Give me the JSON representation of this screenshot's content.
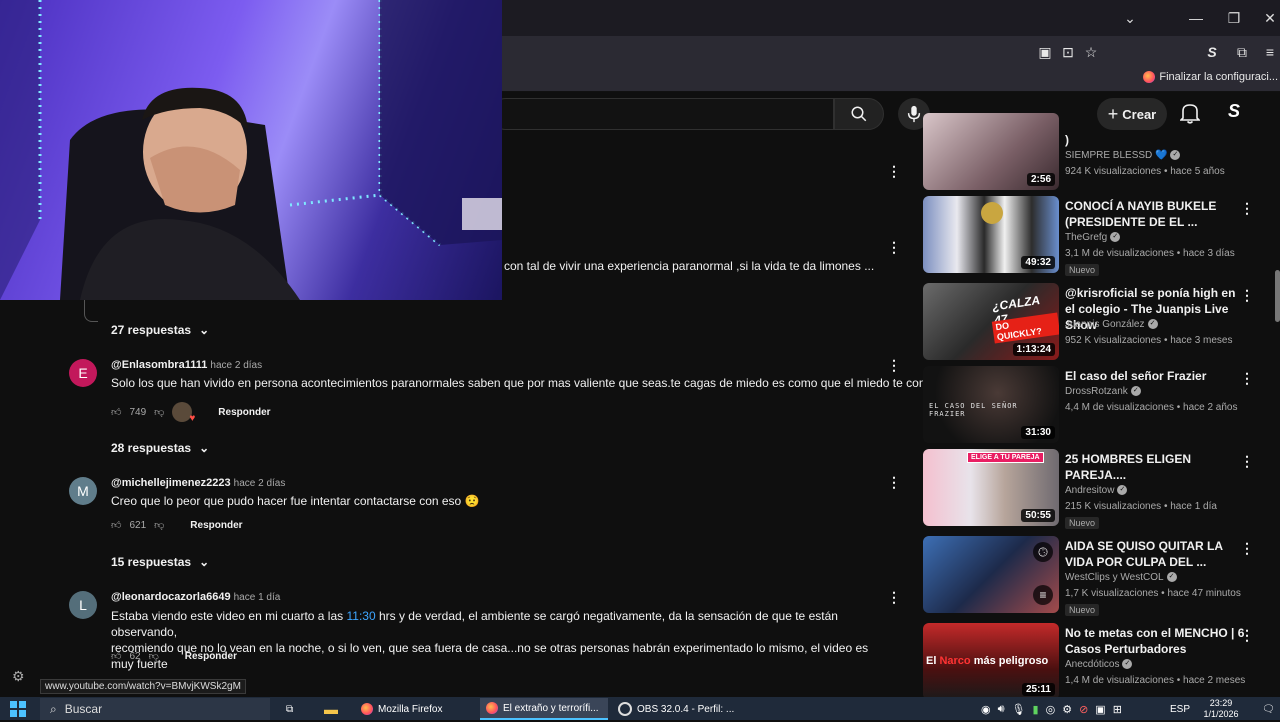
{
  "browser": {
    "bookmark_label": "Finalizar la configuraci...",
    "status_url": "www.youtube.com/watch?v=BMvjKWSk2gM"
  },
  "youtube": {
    "create_label": "Crear"
  },
  "comments": {
    "partial_text": "con tal de vivir una experiencia paranormal ,si la vida te da limones ...",
    "thread1_replies": "27 respuestas",
    "c1": {
      "avatar_letter": "E",
      "author": "@Enlasombra1111",
      "time": "hace 2 días",
      "text": "Solo los que han vivido en persona acontecimientos paranormales saben que por mas valiente que seas.te cagas de miedo es como que el miedo te consume",
      "likes": "749",
      "reply": "Responder",
      "replies": "28 respuestas"
    },
    "c2": {
      "avatar_letter": "M",
      "author": "@michellejimenez2223",
      "time": "hace 2 días",
      "text": "Creo que lo peor que pudo hacer fue intentar contactarse con eso 😟",
      "likes": "621",
      "reply": "Responder",
      "replies": "15 respuestas"
    },
    "c3": {
      "avatar_letter": "L",
      "author": "@leonardocazorla6649",
      "time": "hace 1 día",
      "text_a": "Estaba viendo este video en mi cuarto a las ",
      "text_time": "11:30",
      "text_b": " hrs y de verdad, el ambiente se cargó negativamente, da la sensación de que te están observando,",
      "text_line2": "recomiendo que no lo vean en la noche, o si lo ven, que sea fuera de casa...no se otras personas habrán experimentado lo mismo, el video es muy fuerte",
      "likes": "62",
      "reply": "Responder"
    }
  },
  "sidebar": [
    {
      "title": ")",
      "channel": "SIEMPRE BLESSD 💙",
      "meta": "924 K visualizaciones • hace 5 años",
      "duration": "2:56",
      "badge": ""
    },
    {
      "title": "CONOCÍ A NAYIB BUKELE (PRESIDENTE DE EL ...",
      "channel": "TheGrefg",
      "meta": "3,1 M de visualizaciones • hace 3 días",
      "duration": "49:32",
      "badge": "Nuevo"
    },
    {
      "title": "@krisroficial se ponía high en el colegio - The Juanpis Live Show",
      "channel": "Juanpis González",
      "meta": "952 K visualizaciones • hace 3 meses",
      "duration": "1:13:24",
      "badge": ""
    },
    {
      "title": "El caso del señor Frazier",
      "channel": "DrossRotzank",
      "meta": "4,4 M de visualizaciones • hace 2 años",
      "duration": "31:30",
      "badge": ""
    },
    {
      "title": "25 HOMBRES ELIGEN PAREJA....",
      "channel": "Andresitow",
      "meta": "215 K visualizaciones • hace 1 día",
      "duration": "50:55",
      "badge": "Nuevo"
    },
    {
      "title": "AIDA SE QUISO QUITAR LA VIDA POR CULPA DEL ...",
      "channel": "WestClips y WestCOL",
      "meta": "1,7 K visualizaciones • hace 47 minutos",
      "duration": "",
      "badge": "Nuevo"
    },
    {
      "title": "No te metas con el MENCHO | 6 Casos Perturbadores",
      "channel": "Anecdóticos",
      "meta": "1,4 M de visualizaciones • hace 2 meses",
      "duration": "25:11",
      "badge": ""
    }
  ],
  "thumb_text": {
    "t3a": "¿CALZA 47,",
    "t3b": "DO QUICKLY?",
    "t4": "EL CASO DEL SEÑOR FRAZIER",
    "t5": "ELIGE A TU PAREJA",
    "t7a": "El ",
    "t7b": "Narco",
    "t7c": " más peligroso"
  },
  "taskbar": {
    "search": "Buscar",
    "firefox": "Mozilla Firefox",
    "tab_title": "El extraño y terrorífi...",
    "obs": "OBS 32.0.4 - Perfil: ...",
    "lang": "ESP",
    "time": "23:29",
    "date": "1/1/2026"
  }
}
